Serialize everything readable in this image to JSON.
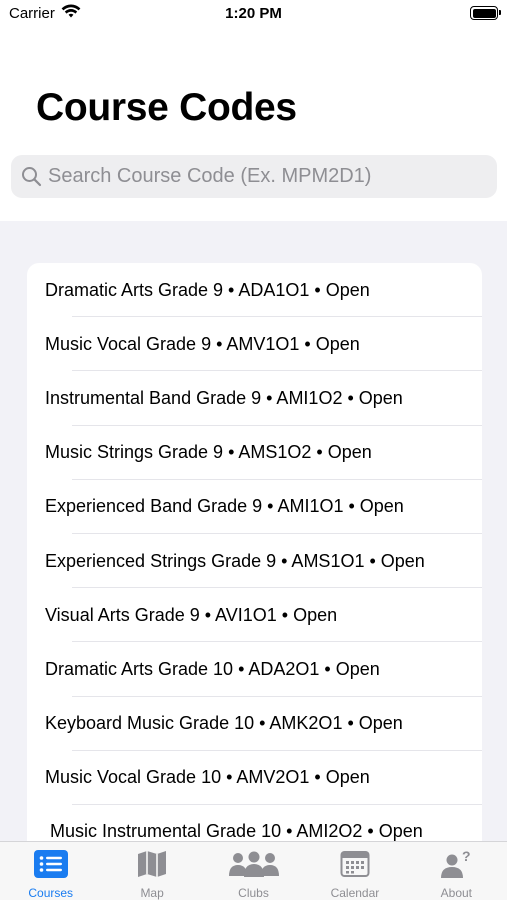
{
  "status_bar": {
    "carrier": "Carrier",
    "time": "1:20 PM"
  },
  "header": {
    "title": "Course Codes"
  },
  "search": {
    "placeholder": "Search Course Code (Ex. MPM2D1)",
    "icon": "magnifying-glass-icon"
  },
  "courses": [
    "Dramatic Arts Grade 9 • ADA1O1 • Open",
    "Music Vocal Grade 9 • AMV1O1 • Open",
    "Instrumental Band Grade 9 • AMI1O2 • Open",
    "Music Strings Grade 9 • AMS1O2 • Open",
    "Experienced Band Grade 9 • AMI1O1 • Open",
    "Experienced Strings Grade 9 • AMS1O1 • Open",
    "Visual Arts Grade 9 • AVI1O1 • Open",
    "Dramatic Arts Grade 10 • ADA2O1 • Open",
    "Keyboard Music Grade 10 • AMK2O1 • Open",
    "Music Vocal Grade 10 • AMV2O1 • Open",
    "Music Instrumental Grade 10 • AMI2O2 • Open"
  ],
  "tabs": [
    {
      "label": "Courses",
      "icon": "list-icon",
      "active": true
    },
    {
      "label": "Map",
      "icon": "map-icon",
      "active": false
    },
    {
      "label": "Clubs",
      "icon": "people-icon",
      "active": false
    },
    {
      "label": "Calendar",
      "icon": "calendar-icon",
      "active": false
    },
    {
      "label": "About",
      "icon": "person-question-icon",
      "active": false
    }
  ],
  "colors": {
    "accent": "#1a7cf0",
    "inactive": "#8e8e93",
    "background": "#f2f2f7"
  }
}
